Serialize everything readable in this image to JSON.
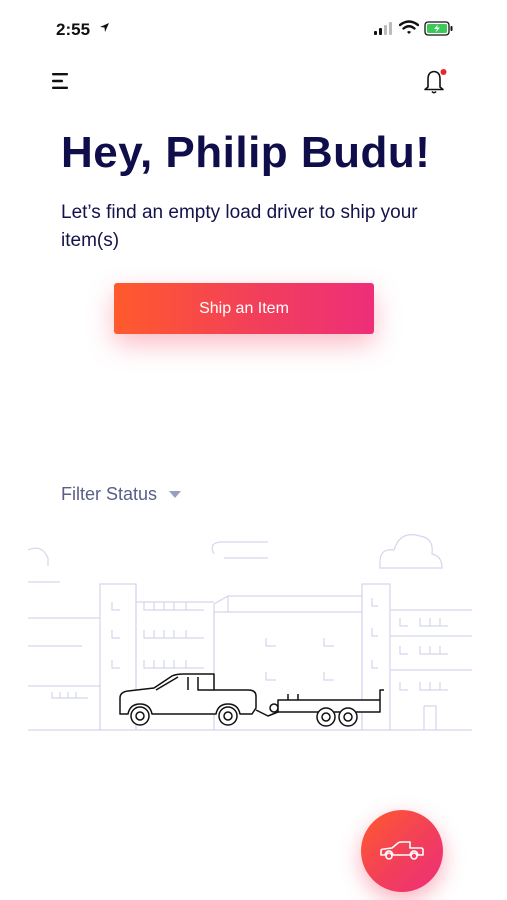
{
  "status_bar": {
    "time": "2:55",
    "icons": [
      "location-arrow-icon",
      "cellular-signal-icon",
      "wifi-icon",
      "battery-charging-icon"
    ]
  },
  "header": {
    "menu_icon": "menu-icon",
    "notification_icon": "bell-icon",
    "notification_badge": true
  },
  "greeting": {
    "title": "Hey, Philip Budu!",
    "subtitle": "Let’s find an empty load driver to ship your item(s)"
  },
  "cta": {
    "label": "Ship an Item"
  },
  "filter": {
    "label": "Filter Status",
    "icon": "caret-down-icon"
  },
  "fab": {
    "icon": "pickup-truck-icon"
  },
  "colors": {
    "primary_text": "#0f0d4a",
    "muted_text": "#5a5f86",
    "gradient_start": "#ff5a2c",
    "gradient_end": "#ee2e79",
    "badge": "#e8262f",
    "illustration_lines": "#d4d6ee"
  }
}
